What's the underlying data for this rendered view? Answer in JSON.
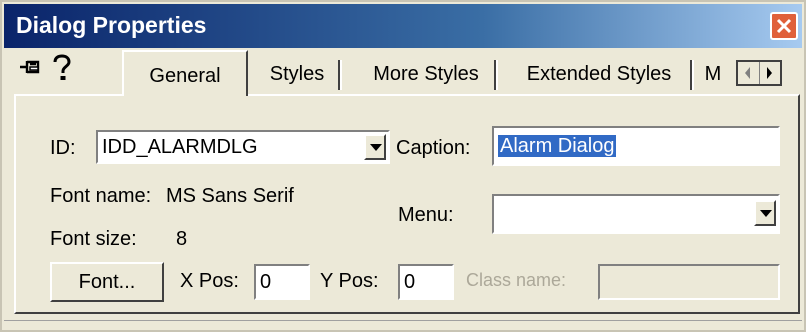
{
  "window": {
    "title": "Dialog Properties"
  },
  "toolbar": {
    "pin_icon": "pushpin-icon",
    "help_icon": "question-mark-icon"
  },
  "tabs": [
    {
      "label": "General",
      "active": true
    },
    {
      "label": "Styles",
      "active": false
    },
    {
      "label": "More Styles",
      "active": false
    },
    {
      "label": "Extended Styles",
      "active": false
    },
    {
      "label": "M",
      "active": false
    }
  ],
  "general": {
    "id_label": "ID:",
    "id_value": "IDD_ALARMDLG",
    "caption_label": "Caption:",
    "caption_value": "Alarm Dialog",
    "font_name_label": "Font name:",
    "font_name_value": "MS Sans Serif",
    "font_size_label": "Font size:",
    "font_size_value": "8",
    "menu_label": "Menu:",
    "menu_value": "",
    "font_button": "Font...",
    "xpos_label": "X Pos:",
    "xpos_value": "0",
    "ypos_label": "Y Pos:",
    "ypos_value": "0",
    "class_name_label": "Class name:",
    "class_name_value": ""
  },
  "colors": {
    "title_start": "#0a246a",
    "title_end": "#a6caf0",
    "dialog_bg": "#ece9d8",
    "selection": "#316ac5"
  }
}
